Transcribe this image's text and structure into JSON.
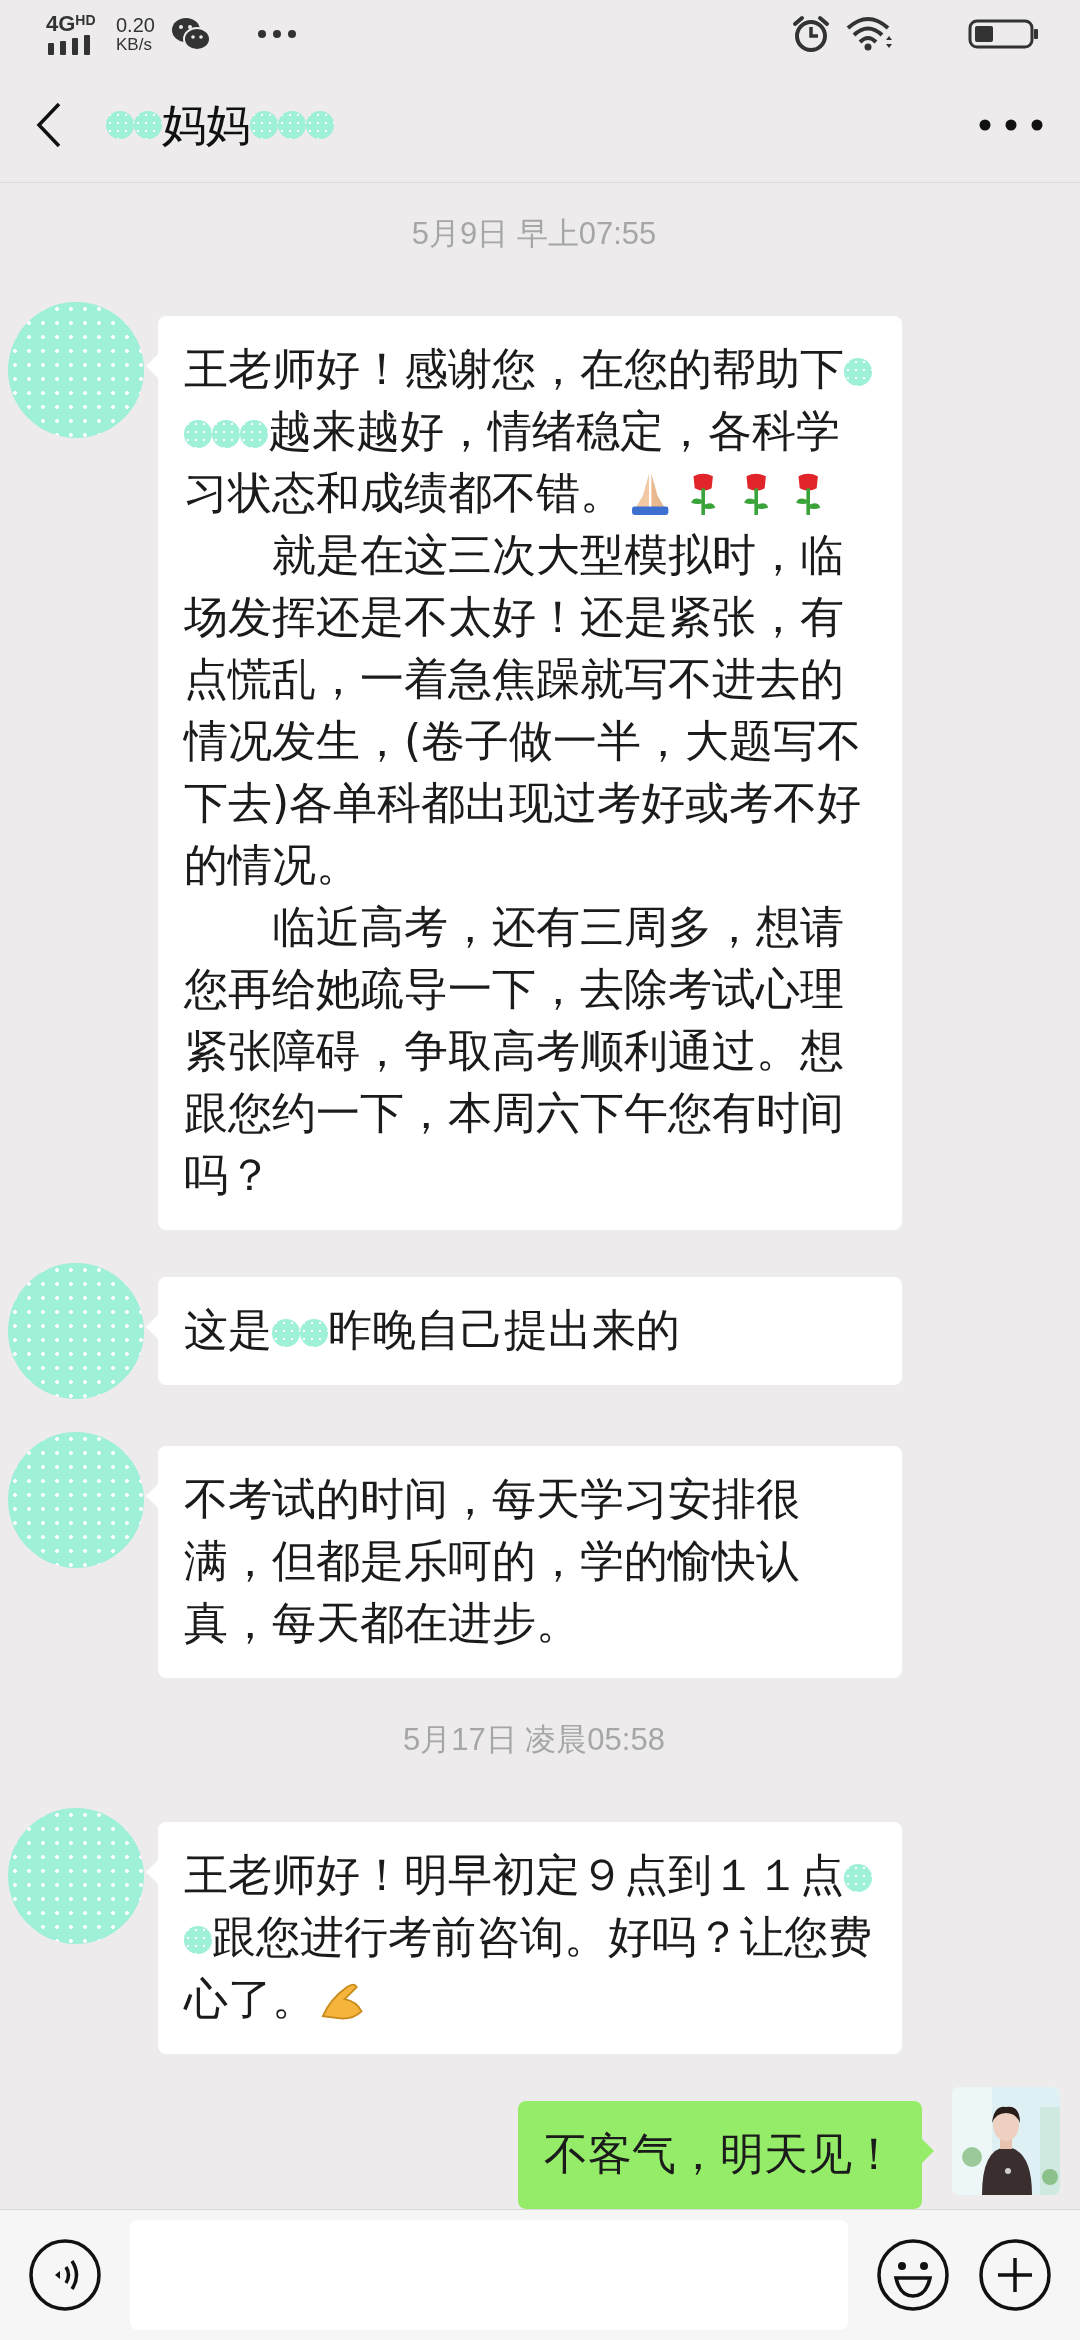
{
  "status_bar": {
    "network": "4G",
    "network_badge": "HD",
    "speed_value": "0.20",
    "speed_unit": "KB/s"
  },
  "header": {
    "title": [
      {
        "kind": "redaction"
      },
      {
        "kind": "redaction"
      },
      {
        "kind": "text",
        "text": "妈妈"
      },
      {
        "kind": "redaction"
      },
      {
        "kind": "redaction"
      },
      {
        "kind": "redaction"
      }
    ]
  },
  "chat": [
    {
      "kind": "timestamp",
      "text": "5月9日 早上07:55"
    },
    {
      "kind": "message",
      "sent": false,
      "paragraphs": [
        {
          "indent": false,
          "segments": [
            {
              "kind": "text",
              "text": "王老师好！感谢您，在您的帮助下"
            },
            {
              "kind": "redaction"
            },
            {
              "kind": "redaction"
            },
            {
              "kind": "redaction"
            },
            {
              "kind": "redaction"
            },
            {
              "kind": "text",
              "text": "越来越好，情绪稳定，各科学习状态和成绩都不错。"
            },
            {
              "kind": "pray"
            },
            {
              "kind": "rose"
            },
            {
              "kind": "rose"
            },
            {
              "kind": "rose"
            }
          ]
        },
        {
          "indent": true,
          "segments": [
            {
              "kind": "text",
              "text": "就是在这三次大型模拟时，临场发挥还是不太好！还是紧张，有点慌乱，一着急焦躁就写不进去的情况发生，(卷子做一半，大题写不下去)各单科都出现过考好或考不好的情况。"
            }
          ]
        },
        {
          "indent": true,
          "segments": [
            {
              "kind": "text",
              "text": "临近高考，还有三周多，想请您再给她疏导一下，去除考试心理紧张障碍，争取高考顺利通过。想跟您约一下，本周六下午您有时间吗？"
            }
          ]
        }
      ]
    },
    {
      "kind": "message",
      "sent": false,
      "paragraphs": [
        {
          "indent": false,
          "segments": [
            {
              "kind": "text",
              "text": "这是"
            },
            {
              "kind": "redaction"
            },
            {
              "kind": "redaction"
            },
            {
              "kind": "text",
              "text": "昨晚自己提出来的"
            }
          ]
        }
      ]
    },
    {
      "kind": "message",
      "sent": false,
      "paragraphs": [
        {
          "indent": false,
          "segments": [
            {
              "kind": "text",
              "text": "不考试的时间，每天学习安排很满，但都是乐呵的，学的愉快认真，每天都在进步。"
            }
          ]
        }
      ]
    },
    {
      "kind": "timestamp",
      "text": "5月17日 凌晨05:58"
    },
    {
      "kind": "message",
      "sent": false,
      "paragraphs": [
        {
          "indent": false,
          "segments": [
            {
              "kind": "text",
              "text": "王老师好！明早初定９点到１１点"
            },
            {
              "kind": "redaction"
            },
            {
              "kind": "redaction"
            },
            {
              "kind": "text",
              "text": "跟您进行考前咨询。好吗？让您费心了。"
            },
            {
              "kind": "pinch"
            }
          ]
        }
      ]
    },
    {
      "kind": "message",
      "sent": true,
      "paragraphs": [
        {
          "indent": false,
          "segments": [
            {
              "kind": "text",
              "text": "不客气，明天见！"
            }
          ]
        }
      ]
    }
  ]
}
